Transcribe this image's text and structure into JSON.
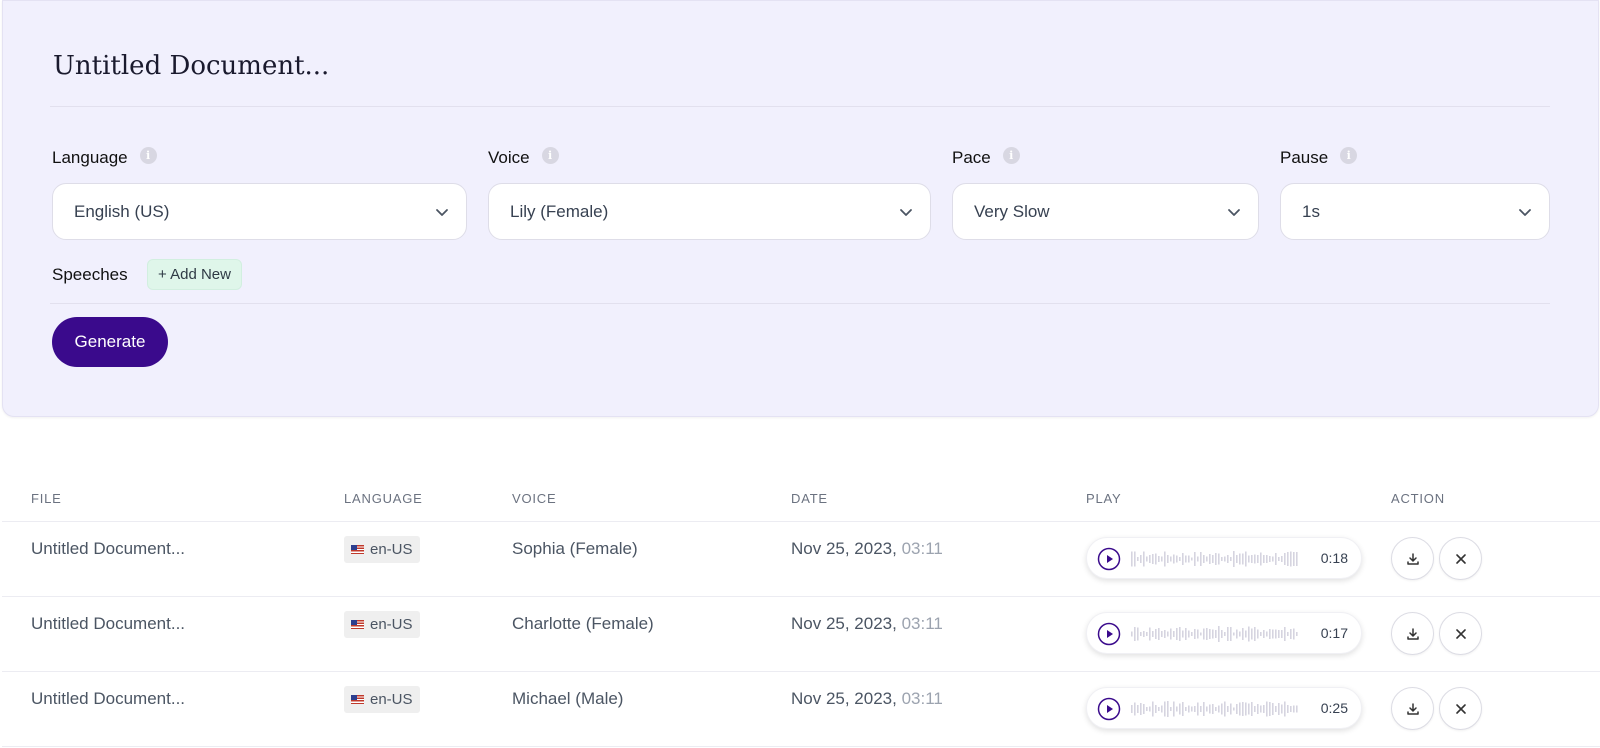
{
  "editor": {
    "title": "Untitled Document...",
    "fields": {
      "language": {
        "label": "Language",
        "value": "English (US)"
      },
      "voice": {
        "label": "Voice",
        "value": "Lily (Female)"
      },
      "pace": {
        "label": "Pace",
        "value": "Very Slow"
      },
      "pause": {
        "label": "Pause",
        "value": "1s"
      }
    },
    "info_glyph": "i",
    "speeches_label": "Speeches",
    "add_new_label": "+ Add New",
    "generate_label": "Generate"
  },
  "table": {
    "headers": {
      "file": "FILE",
      "language": "LANGUAGE",
      "voice": "VOICE",
      "date": "DATE",
      "play": "PLAY",
      "action": "ACTION"
    },
    "rows": [
      {
        "file": "Untitled Document...",
        "language": "en-US",
        "voice": "Sophia (Female)",
        "date": "Nov 25, 2023,",
        "time": "03:11",
        "duration": "0:18"
      },
      {
        "file": "Untitled Document...",
        "language": "en-US",
        "voice": "Charlotte (Female)",
        "date": "Nov 25, 2023,",
        "time": "03:11",
        "duration": "0:17"
      },
      {
        "file": "Untitled Document...",
        "language": "en-US",
        "voice": "Michael (Male)",
        "date": "Nov 25, 2023,",
        "time": "03:11",
        "duration": "0:25"
      }
    ]
  },
  "icons": {
    "info": "info-icon",
    "dropdown": "chevron-down-icon",
    "play": "play-icon",
    "download": "download-icon",
    "delete": "close-icon",
    "flag": "us-flag-icon"
  },
  "colors": {
    "panel_bg": "#f1f0fd",
    "primary": "#3a0a8c",
    "add_new_bg": "#dff6ea",
    "waveform": "#d6d4e0"
  }
}
